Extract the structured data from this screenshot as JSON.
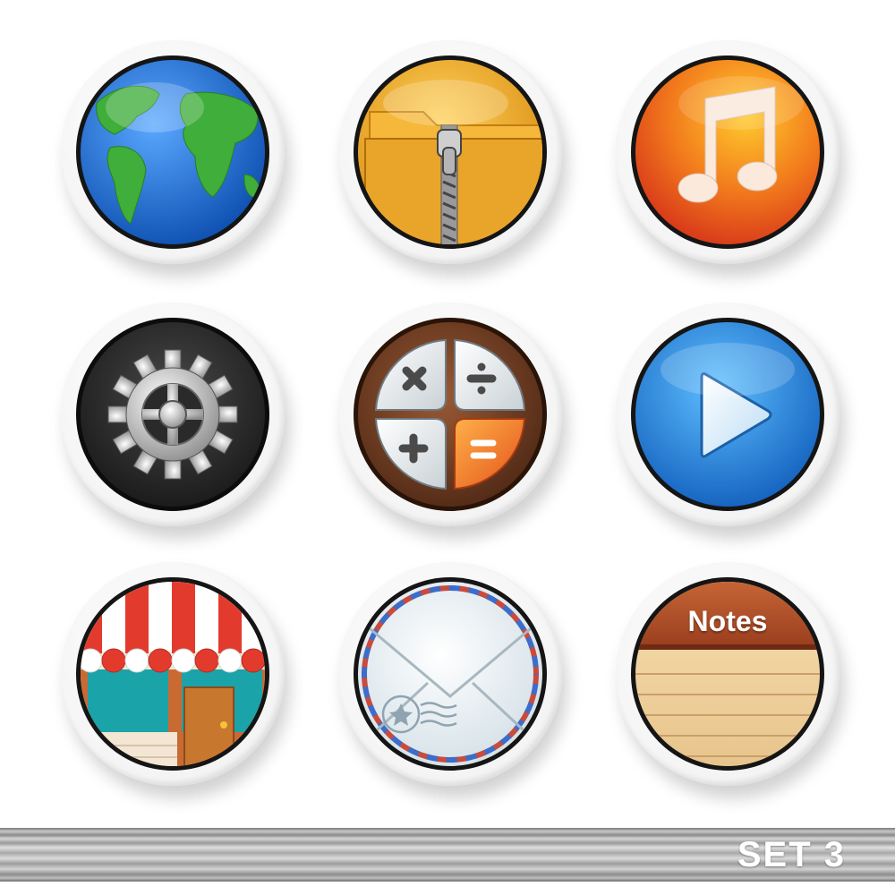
{
  "icons": [
    {
      "name": "globe-icon"
    },
    {
      "name": "zip-folder-icon"
    },
    {
      "name": "music-note-icon"
    },
    {
      "name": "gear-icon"
    },
    {
      "name": "calculator-icon"
    },
    {
      "name": "play-icon"
    },
    {
      "name": "store-icon"
    },
    {
      "name": "mail-icon"
    },
    {
      "name": "notes-icon",
      "label": "Notes"
    }
  ],
  "footer": {
    "label": "SET 3"
  },
  "colors": {
    "globe_ocean": "#1f6fd6",
    "globe_land": "#3fae3a",
    "folder": "#f2b233",
    "music_bg": "#e8551d",
    "gear_bg": "#2c2c2c",
    "calc_ring": "#6b3a22",
    "calc_equals": "#f06a1a",
    "play_bg": "#1e7fd8",
    "awning_red": "#e23b2e",
    "store_teal": "#1aa3a8",
    "notes_header": "#b5532a",
    "notes_paper": "#f0d3a0"
  }
}
